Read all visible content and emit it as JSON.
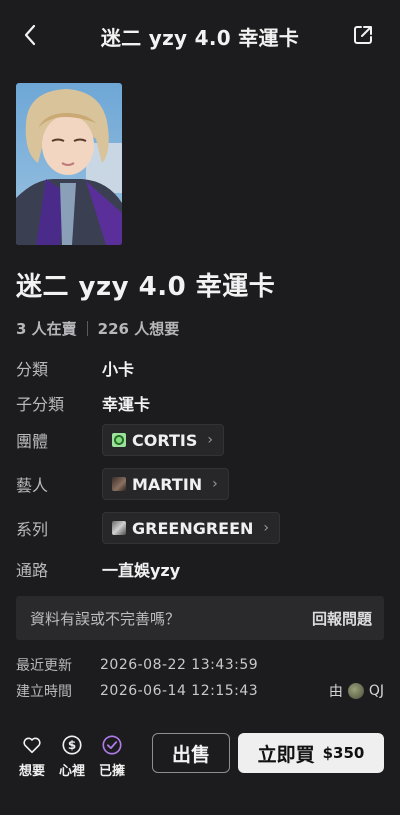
{
  "header": {
    "title": "迷二 yzy 4.0 幸運卡",
    "back_icon": "chevron-left-icon",
    "share_icon": "share-icon"
  },
  "product": {
    "name": "迷二 yzy 4.0 幸運卡",
    "stats": {
      "selling": "3 人在賣",
      "wanting": "226 人想要"
    },
    "fields": {
      "category": {
        "label": "分類",
        "value": "小卡"
      },
      "subcategory": {
        "label": "子分類",
        "value": "幸運卡"
      },
      "group": {
        "label": "團體",
        "value": "CORTIS"
      },
      "artist": {
        "label": "藝人",
        "value": "MARTIN"
      },
      "series": {
        "label": "系列",
        "value": "GREENGREEN"
      },
      "channel": {
        "label": "通路",
        "value": "一直娛yzy"
      }
    }
  },
  "report": {
    "question": "資料有誤或不完善嗎？",
    "action": "回報問題"
  },
  "meta": {
    "updated": {
      "label": "最近更新",
      "value": "2026-08-22 13:43:59"
    },
    "created": {
      "label": "建立時間",
      "value": "2026-06-14 12:15:43"
    },
    "creator_prefix": "由",
    "creator": "QJ"
  },
  "bottom": {
    "want": "想要",
    "wishlist": "心裡",
    "owned": "已擁",
    "sell": "出售",
    "buy": "立即買",
    "price": "$350"
  },
  "colors": {
    "background": "#1c1c1e",
    "owned_accent": "#b07be8",
    "buy_bg": "#efefef"
  }
}
